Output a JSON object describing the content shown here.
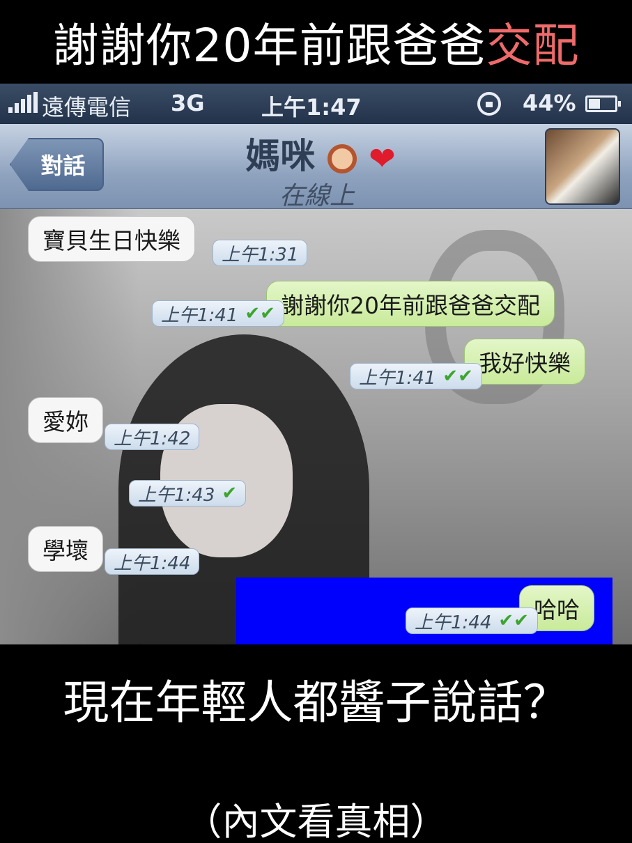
{
  "top_caption": {
    "text_plain": "謝謝你20年前跟爸爸",
    "text_highlight": "交配",
    "highlight_color": "#ef6b6b"
  },
  "status_bar": {
    "carrier": "遠傳電信",
    "network": "3G",
    "time": "上午1:47",
    "battery": "44%"
  },
  "nav_bar": {
    "back_label": "對話",
    "contact_name": "媽咪",
    "contact_emoji_1": "woman-face-emoji",
    "contact_emoji_2": "❤",
    "status": "在線上"
  },
  "messages": [
    {
      "direction": "in",
      "text": "寶貝生日快樂",
      "time": "上午1:31"
    },
    {
      "direction": "out",
      "text": "謝謝你20年前跟爸爸交配",
      "time": "上午1:41",
      "ticks": "✔✔"
    },
    {
      "direction": "out",
      "text": "我好快樂",
      "time": "上午1:41",
      "ticks": "✔✔"
    },
    {
      "direction": "in",
      "text": "愛妳",
      "time": "上午1:42"
    },
    {
      "direction": "out",
      "text": "",
      "time": "上午1:43",
      "ticks": "✔"
    },
    {
      "direction": "in",
      "text": "學壞",
      "time": "上午1:44"
    },
    {
      "direction": "out",
      "text": "哈哈",
      "time": "上午1:44",
      "ticks": "✔✔"
    }
  ],
  "redaction_color": "#0000fd",
  "bottom_caption": {
    "line1": "現在年輕人都醬子說話？",
    "line2": "（內文看真相）"
  }
}
